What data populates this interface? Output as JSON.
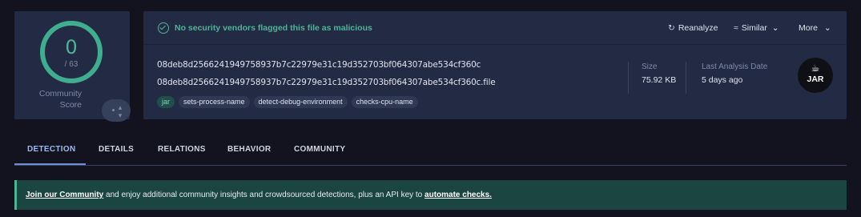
{
  "score": {
    "detections": "0",
    "total": "/ 63",
    "community_label_1": "Community",
    "community_label_2": "Score",
    "community_arrows": "▴▾",
    "ring_color": "#3fae8e"
  },
  "status": {
    "icon": "check-circle-icon",
    "text": "No security vendors flagged this file as malicious",
    "color": "#4cb694"
  },
  "actions": [
    {
      "icon": "refresh-icon",
      "glyph": "↻",
      "label": "Reanalyze"
    },
    {
      "icon": "similar-icon",
      "glyph": "≈",
      "label": "Similar",
      "caret": "⌄"
    },
    {
      "label": "More",
      "caret": "⌄"
    }
  ],
  "file": {
    "sha256": "08deb8d2566241949758937b7c22979e31c19d352703bf064307abe534cf360c",
    "name": "08deb8d2566241949758937b7c22979e31c19d352703bf064307abe534cf360c.file",
    "tags": [
      "jar",
      "sets-process-name",
      "detect-debug-environment",
      "checks-cpu-name"
    ],
    "size_label": "Size",
    "size_value": "75.92 KB",
    "last_analysis_label": "Last Analysis Date",
    "last_analysis_value": "5 days ago",
    "type_badge": "JAR",
    "type_badge_icon": "java-cup-icon"
  },
  "tabs": [
    {
      "label": "DETECTION",
      "active": true
    },
    {
      "label": "DETAILS"
    },
    {
      "label": "RELATIONS"
    },
    {
      "label": "BEHAVIOR"
    },
    {
      "label": "COMMUNITY"
    }
  ],
  "banner": {
    "link1": "Join our Community",
    "text": " and enjoy additional community insights and crowdsourced detections, plus an API key to ",
    "link2": "automate checks.",
    "accent": "#4cb694"
  }
}
